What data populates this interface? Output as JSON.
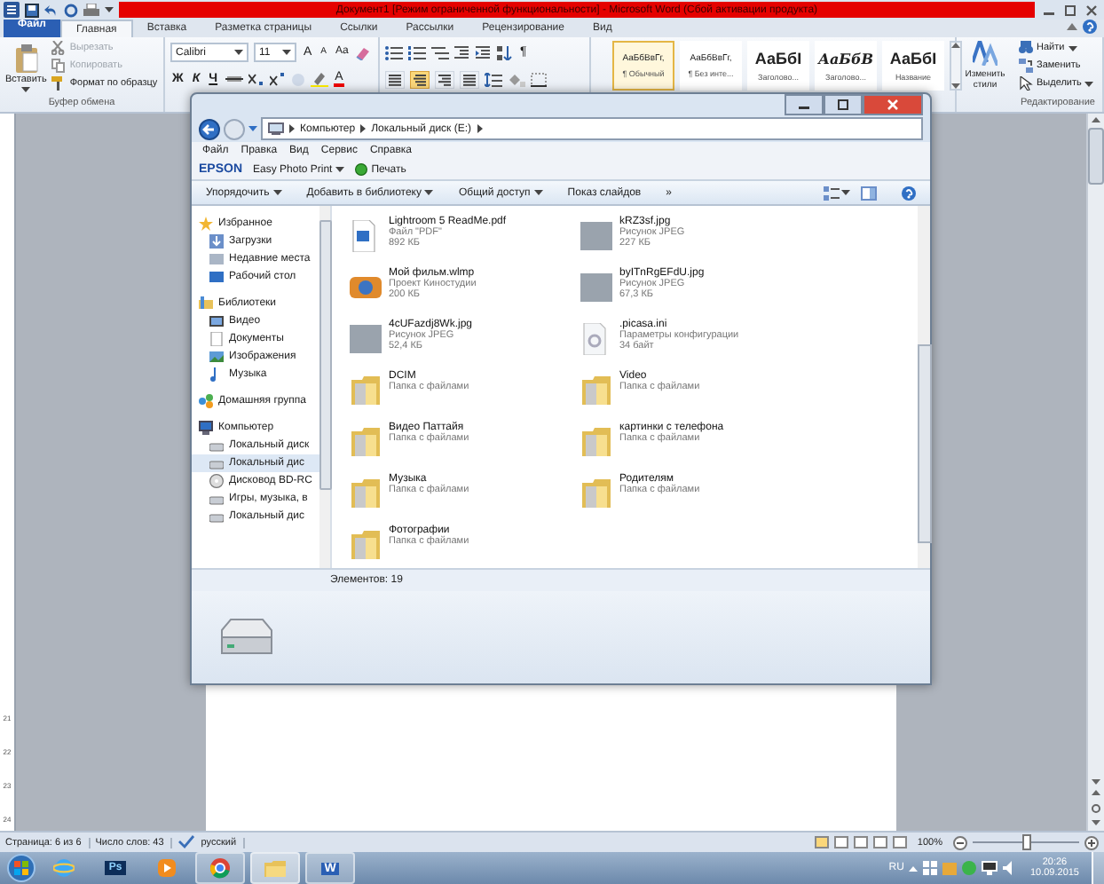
{
  "word": {
    "title": "Документ1 [Режим ограниченной функциональности] - Microsoft Word (Сбой активации продукта)",
    "tabs": [
      {
        "label": "Файл",
        "kind": "backstage",
        "selected": false
      },
      {
        "label": "Главная",
        "kind": "tab",
        "selected": true
      },
      {
        "label": "Вставка",
        "kind": "tab",
        "selected": false
      },
      {
        "label": "Разметка страницы",
        "kind": "tab",
        "selected": false
      },
      {
        "label": "Ссылки",
        "kind": "tab",
        "selected": false
      },
      {
        "label": "Рассылки",
        "kind": "tab",
        "selected": false
      },
      {
        "label": "Рецензирование",
        "kind": "tab",
        "selected": false
      },
      {
        "label": "Вид",
        "kind": "tab",
        "selected": false
      }
    ],
    "clipboard": {
      "paste": "Вставить",
      "items": [
        {
          "label": "Вырезать",
          "kind": "cut",
          "disabled": true
        },
        {
          "label": "Копировать",
          "kind": "copy",
          "disabled": true
        },
        {
          "label": "Формат по образцу",
          "kind": "painter",
          "disabled": false
        }
      ],
      "group_label": "Буфер обмена"
    },
    "font": {
      "name": "Calibri",
      "size": "11",
      "size_buttons": [
        "A",
        "A"
      ],
      "case_button": "Aa",
      "style_buttons": [
        "Ж",
        "К",
        "Ч"
      ],
      "color_button": "A"
    },
    "paragraph": {
      "pilcrow": "¶",
      "alignment": [
        {
          "selected": false
        },
        {
          "selected": true
        },
        {
          "selected": false
        },
        {
          "selected": false
        }
      ]
    },
    "styles": [
      {
        "preview": "АаБбВвГг,",
        "name": "¶ Обычный",
        "kind": "body",
        "selected": true
      },
      {
        "preview": "АаБбВвГг,",
        "name": "¶ Без инте...",
        "kind": "body",
        "selected": false
      },
      {
        "preview": "АаБбI",
        "name": "Заголово...",
        "kind": "heading",
        "selected": false
      },
      {
        "preview": "АаБбВ",
        "name": "Заголово...",
        "kind": "italic",
        "selected": false
      },
      {
        "preview": "АаБбI",
        "name": "Название",
        "kind": "heading",
        "selected": false
      }
    ],
    "change_styles": "Изменить стили",
    "editing": {
      "items": [
        {
          "label": "Найти",
          "kind": "find",
          "dropdown": true
        },
        {
          "label": "Заменить",
          "kind": "replace",
          "dropdown": false
        },
        {
          "label": "Выделить",
          "kind": "select",
          "dropdown": true
        }
      ],
      "group_label": "Редактирование"
    },
    "ruler": [
      "21",
      "22",
      "23",
      "24"
    ],
    "status_bar": {
      "page": "Страница: 6 из 6",
      "words": "Число слов: 43",
      "language": "русский",
      "zoom": "100%",
      "zoom_slider": {
        "level": 0.5
      }
    }
  },
  "explorer": {
    "breadcrumb": [
      "Компьютер",
      "Локальный диск (E:)"
    ],
    "menu": [
      "Файл",
      "Правка",
      "Вид",
      "Сервис",
      "Справка"
    ],
    "epson": {
      "brand": "EPSON",
      "app": "Easy Photo Print",
      "print": "Печать"
    },
    "toolbar": [
      {
        "label": "Упорядочить",
        "dropdown": true
      },
      {
        "label": "Добавить в библиотеку",
        "dropdown": true
      },
      {
        "label": "Общий доступ",
        "dropdown": true
      },
      {
        "label": "Показ слайдов",
        "dropdown": false
      }
    ],
    "more": "»",
    "nav": [
      {
        "label": "Избранное",
        "kind": "star",
        "selected": false,
        "children": [
          {
            "label": "Загрузки",
            "kind": "download",
            "selected": false
          },
          {
            "label": "Недавние места",
            "kind": "recent",
            "selected": false
          },
          {
            "label": "Рабочий стол",
            "kind": "desktop",
            "selected": false
          }
        ]
      },
      {
        "label": "Библиотеки",
        "kind": "library",
        "selected": false,
        "children": [
          {
            "label": "Видео",
            "kind": "video",
            "selected": false
          },
          {
            "label": "Документы",
            "kind": "documents",
            "selected": false
          },
          {
            "label": "Изображения",
            "kind": "pictures",
            "selected": false
          },
          {
            "label": "Музыка",
            "kind": "music",
            "selected": false
          }
        ]
      },
      {
        "label": "Домашняя группа",
        "kind": "homegroup",
        "selected": false
      },
      {
        "label": "Компьютер",
        "kind": "computer",
        "selected": false,
        "children": [
          {
            "label": "Локальный диск",
            "kind": "drive",
            "selected": false
          },
          {
            "label": "Локальный дис",
            "kind": "drive",
            "selected": true
          },
          {
            "label": "Дисковод BD-RC",
            "kind": "optical",
            "selected": false
          },
          {
            "label": "Игры, музыка, в",
            "kind": "drive",
            "selected": false
          },
          {
            "label": "Локальный дис",
            "kind": "drive",
            "selected": false
          }
        ]
      }
    ],
    "files": [
      {
        "name": "Lightroom 5 ReadMe.pdf",
        "type": "Файл \"PDF\"",
        "size": "892 КБ",
        "kind": "document"
      },
      {
        "name": "kRZ3sf.jpg",
        "type": "Рисунок JPEG",
        "size": "227 КБ",
        "kind": "image"
      },
      {
        "name": "Мой фильм.wlmp",
        "type": "Проект Киностудии",
        "size": "200 КБ",
        "kind": "movie"
      },
      {
        "name": "byITnRgEFdU.jpg",
        "type": "Рисунок JPEG",
        "size": "67,3 КБ",
        "kind": "image"
      },
      {
        "name": "4cUFazdj8Wk.jpg",
        "type": "Рисунок JPEG",
        "size": "52,4 КБ",
        "kind": "image"
      },
      {
        "name": ".picasa.ini",
        "type": "Параметры конфигурации",
        "size": "34 байт",
        "kind": "config"
      },
      {
        "name": "DCIM",
        "type": "Папка с файлами",
        "kind": "folder"
      },
      {
        "name": "Video",
        "type": "Папка с файлами",
        "kind": "folder"
      },
      {
        "name": "Видео Паттайя",
        "type": "Папка с файлами",
        "kind": "folder"
      },
      {
        "name": "картинки с телефона",
        "type": "Папка с файлами",
        "kind": "folder"
      },
      {
        "name": "Музыка",
        "type": "Папка с файлами",
        "kind": "folder"
      },
      {
        "name": "Родителям",
        "type": "Папка с файлами",
        "kind": "folder"
      },
      {
        "name": "Фотографии",
        "type": "Папка с файлами",
        "kind": "folder"
      }
    ],
    "status": "Элементов: 19"
  },
  "taskbar": {
    "apps": [
      {
        "kind": "ie",
        "running": false,
        "selected": false
      },
      {
        "kind": "photoshop",
        "label": "Ps",
        "running": false,
        "selected": false
      },
      {
        "kind": "media",
        "running": false,
        "selected": false
      },
      {
        "kind": "chrome",
        "running": true,
        "selected": false
      },
      {
        "kind": "folder",
        "running": true,
        "selected": true
      },
      {
        "kind": "word",
        "label": "W",
        "running": true,
        "selected": false
      }
    ],
    "language": "RU",
    "time": "20:26",
    "date": "10.09.2015"
  }
}
